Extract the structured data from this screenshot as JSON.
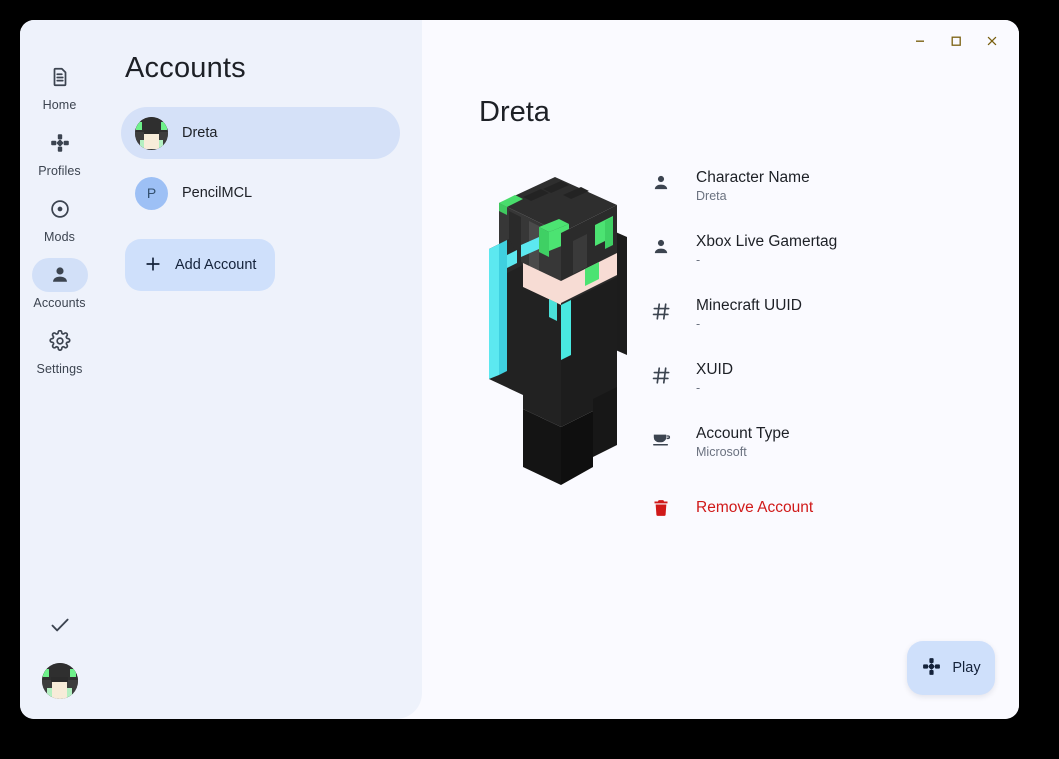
{
  "window": {
    "controls": {
      "minimize": "minimize-icon",
      "maximize": "maximize-icon",
      "close": "close-icon"
    }
  },
  "rail": {
    "items": [
      {
        "label": "Home",
        "icon": "document-icon",
        "active": false
      },
      {
        "label": "Profiles",
        "icon": "dpad-icon",
        "active": false
      },
      {
        "label": "Mods",
        "icon": "target-icon",
        "active": false
      },
      {
        "label": "Accounts",
        "icon": "person-icon",
        "active": true
      },
      {
        "label": "Settings",
        "icon": "gear-icon",
        "active": false
      }
    ],
    "bottom": {
      "check_icon": "check-icon",
      "avatar_icon": "user-avatar-icon"
    }
  },
  "accounts_panel": {
    "title": "Accounts",
    "accounts": [
      {
        "name": "Dreta",
        "avatar_type": "skin",
        "initial": "",
        "selected": true
      },
      {
        "name": "PencilMCL",
        "avatar_type": "letter",
        "initial": "P",
        "selected": false
      }
    ],
    "add_button": {
      "label": "Add Account",
      "icon": "plus-icon"
    }
  },
  "detail": {
    "title": "Dreta",
    "skin_preview": "minecraft-skin-render",
    "rows": [
      {
        "icon": "person-icon",
        "label": "Character Name",
        "value": "Dreta",
        "action": "open-external-icon"
      },
      {
        "icon": "person-icon",
        "label": "Xbox Live Gamertag",
        "value": "-",
        "action": "open-external-icon"
      },
      {
        "icon": "hash-icon",
        "label": "Minecraft UUID",
        "value": "-",
        "action": ""
      },
      {
        "icon": "hash-icon",
        "label": "XUID",
        "value": "-",
        "action": ""
      },
      {
        "icon": "mug-icon",
        "label": "Account Type",
        "value": "Microsoft",
        "action": ""
      }
    ],
    "remove": {
      "label": "Remove Account",
      "icon": "trash-icon"
    }
  },
  "play_button": {
    "label": "Play",
    "icon": "dpad-icon"
  },
  "colors": {
    "panel_bg": "#eef2fb",
    "content_bg": "#fafaff",
    "accent_pill": "#d5e1f8",
    "accent_button": "#cfe0fb",
    "text_primary": "#1d2026",
    "text_secondary": "#6b7280",
    "danger": "#d01919",
    "letter_avatar": "#9dc0f5"
  }
}
